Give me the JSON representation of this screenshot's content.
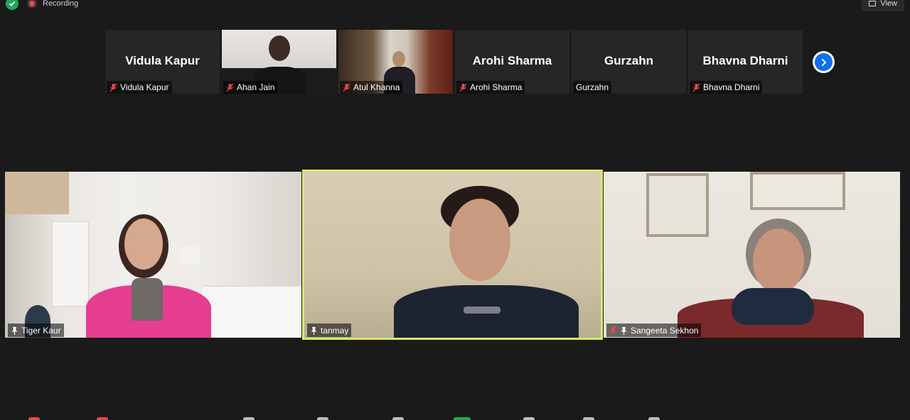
{
  "topbar": {
    "recording_label": "Recording",
    "view_label": "View"
  },
  "gallery": {
    "tiles": [
      {
        "display_name": "Vidula Kapur",
        "label": "Vidula Kapur",
        "muted": true,
        "video": false
      },
      {
        "display_name": "",
        "label": "Ahan Jain",
        "muted": true,
        "video": true
      },
      {
        "display_name": "",
        "label": "Atul Khanna",
        "muted": true,
        "video": true
      },
      {
        "display_name": "Arohi Sharma",
        "label": "Arohi Sharma",
        "muted": true,
        "video": false
      },
      {
        "display_name": "Gurzahn",
        "label": "Gurzahn",
        "muted": false,
        "video": false
      },
      {
        "display_name": "Bhavna Dharni",
        "label": "Bhavna Dharni",
        "muted": true,
        "video": false
      }
    ]
  },
  "main": {
    "tiles": [
      {
        "label": "Tiger Kaur",
        "pinned": true,
        "muted": false
      },
      {
        "label": "tanmay",
        "pinned": true,
        "muted": false,
        "active_speaker": true
      },
      {
        "label": "Sangeeta Sekhon",
        "pinned": true,
        "muted": true
      }
    ]
  },
  "colors": {
    "active_speaker_border": "#d9e86a",
    "next_button": "#0e71eb",
    "mute_icon": "#e5484d",
    "shield": "#23a55a"
  },
  "icons": [
    "shield-check-icon",
    "record-icon",
    "grid-view-icon",
    "mic-off-icon",
    "pin-icon",
    "chevron-right-icon"
  ]
}
